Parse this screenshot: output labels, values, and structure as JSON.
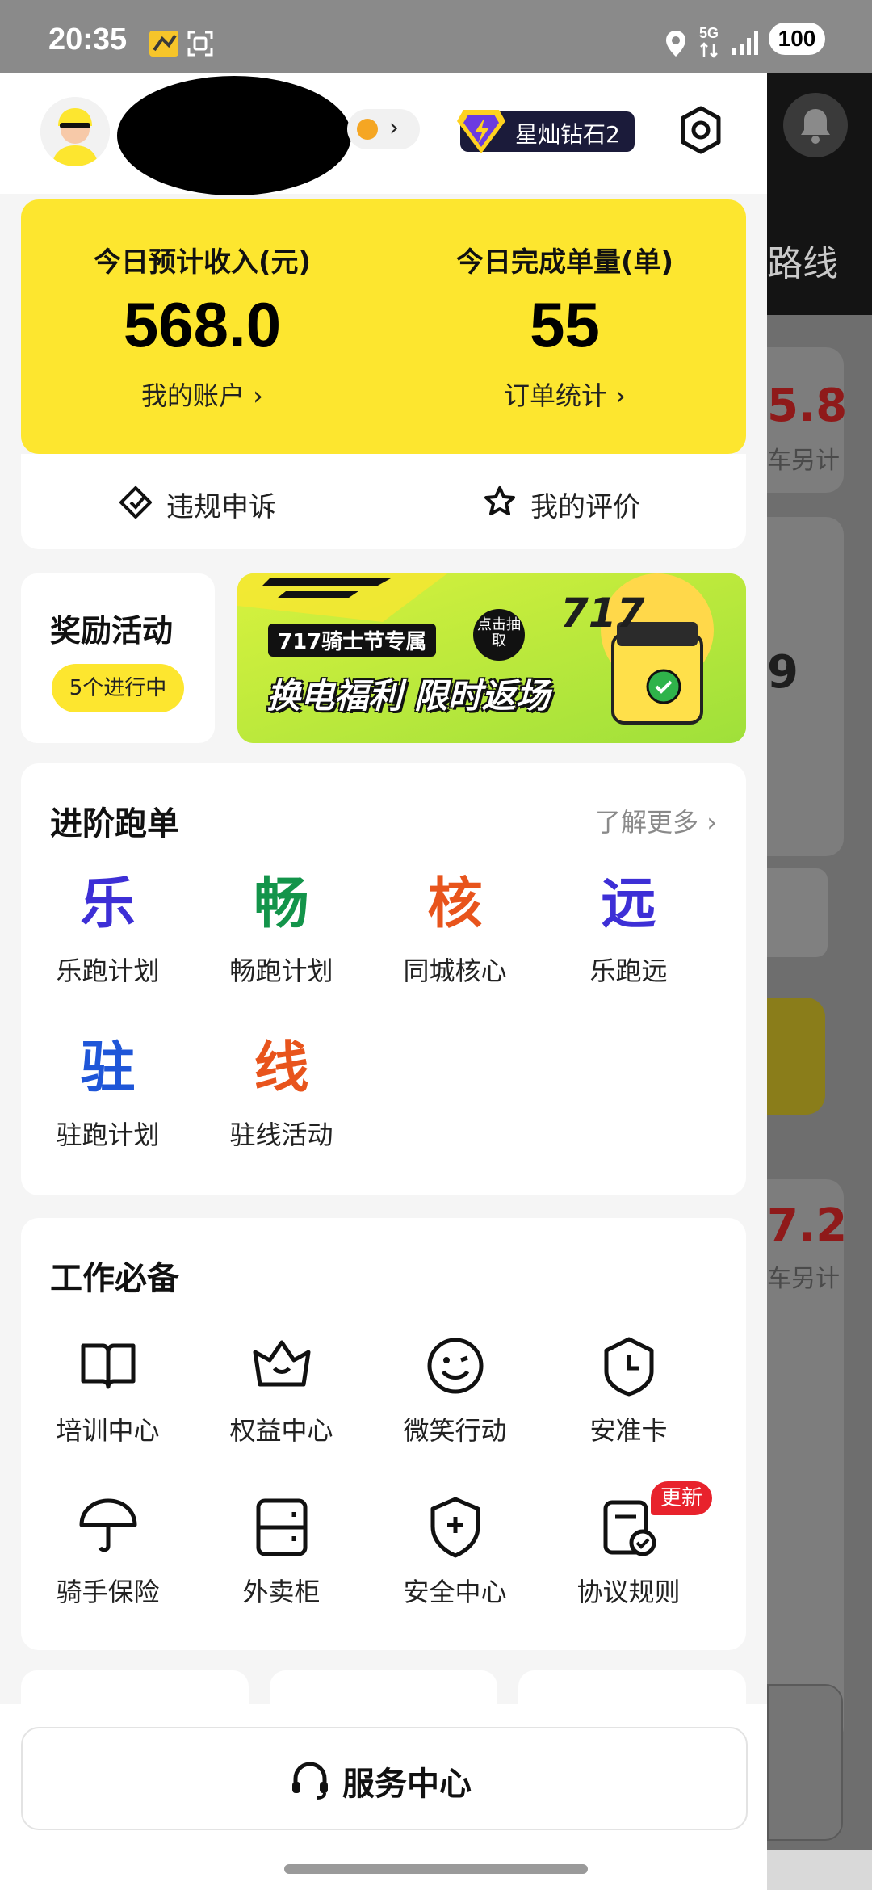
{
  "status_bar": {
    "time": "20:35",
    "network": "5G",
    "battery": "100"
  },
  "header": {
    "vip_label": "星灿钻石2"
  },
  "earnings": {
    "income_label": "今日预计收入(元)",
    "income_value": "568.0",
    "account_link": "我的账户 ›",
    "orders_label": "今日完成单量(单)",
    "orders_value": "55",
    "orders_link": "订单统计 ›"
  },
  "actions": {
    "appeal": "违规申诉",
    "rating": "我的评价"
  },
  "rewards": {
    "title": "奖励活动",
    "status": "5个进行中"
  },
  "banner": {
    "tag": "717骑士节专属",
    "headline": "换电福利 限时返场",
    "cta": "点击抽取",
    "big_text": "717"
  },
  "advanced": {
    "title": "进阶跑单",
    "more": "了解更多 ›",
    "items": [
      {
        "glyph": "乐",
        "label": "乐跑计划",
        "color": "#3d2fd6"
      },
      {
        "glyph": "畅",
        "label": "畅跑计划",
        "color": "#13944a"
      },
      {
        "glyph": "核",
        "label": "同城核心",
        "color": "#e8541c"
      },
      {
        "glyph": "远",
        "label": "乐跑远",
        "color": "#3d2fd6"
      },
      {
        "glyph": "驻",
        "label": "驻跑计划",
        "color": "#1f56d8"
      },
      {
        "glyph": "线",
        "label": "驻线活动",
        "color": "#e8541c"
      }
    ]
  },
  "essentials": {
    "title": "工作必备",
    "items": [
      {
        "icon": "book-icon",
        "label": "培训中心"
      },
      {
        "icon": "crown-icon",
        "label": "权益中心"
      },
      {
        "icon": "smile-icon",
        "label": "微笑行动"
      },
      {
        "icon": "clock-shield-icon",
        "label": "安准卡"
      },
      {
        "icon": "umbrella-icon",
        "label": "骑手保险"
      },
      {
        "icon": "locker-icon",
        "label": "外卖柜"
      },
      {
        "icon": "shield-plus-icon",
        "label": "安全中心"
      },
      {
        "icon": "document-check-icon",
        "label": "协议规则"
      }
    ],
    "new_badge": "更新"
  },
  "background_app": {
    "route_text": "路线",
    "value_1": "5.8",
    "caption_1": "车另计",
    "value_2": "9",
    "value_3": "7.2",
    "caption_2": "车另计"
  },
  "service": {
    "label": "服务中心"
  }
}
